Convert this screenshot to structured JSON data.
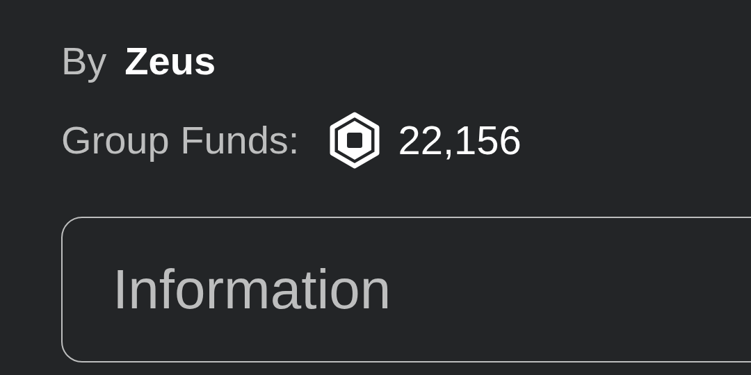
{
  "creator": {
    "prefix": "By",
    "name": "Zeus"
  },
  "funds": {
    "label": "Group Funds:",
    "amount": "22,156"
  },
  "section": {
    "title": "Information"
  }
}
